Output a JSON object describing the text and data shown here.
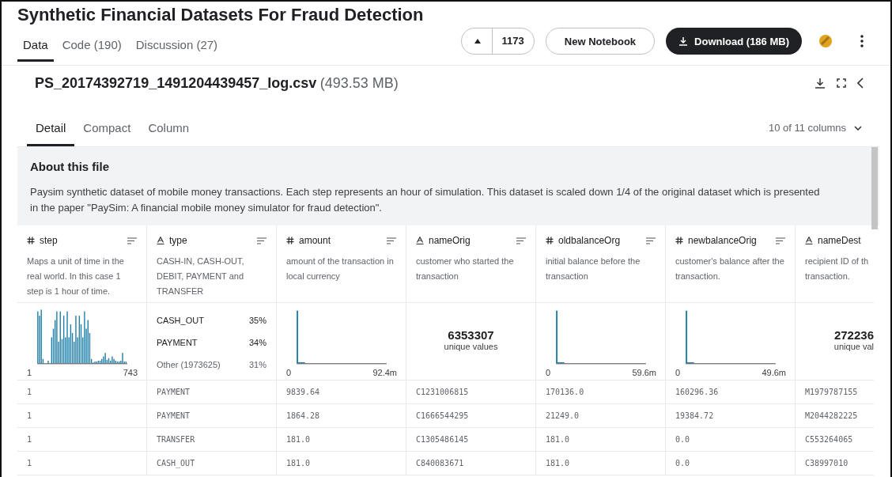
{
  "title": "Synthetic Financial Datasets For Fraud Detection",
  "tabs": [
    {
      "label": "Data",
      "selected": true
    },
    {
      "label": "Code (190)",
      "selected": false
    },
    {
      "label": "Discussion (27)",
      "selected": false
    }
  ],
  "upvote": {
    "count": "1173"
  },
  "new_notebook": "New Notebook",
  "download": "Download (186 MB)",
  "file": {
    "name": "PS_20174392719_1491204439457_log.csv",
    "size": "(493.53 MB)"
  },
  "view_tabs": [
    {
      "label": "Detail",
      "selected": true
    },
    {
      "label": "Compact",
      "selected": false
    },
    {
      "label": "Column",
      "selected": false
    }
  ],
  "columns_selector": "10 of 11 columns",
  "about": {
    "heading": "About this file",
    "text": "Paysim synthetic dataset of mobile money transactions. Each step represents an hour of simulation. This dataset is scaled down 1/4 of the original dataset which is presented in the paper \"PaySim: A financial mobile money simulator for fraud detection\"."
  },
  "table": {
    "columns": [
      {
        "name": "step",
        "kind": "numeric",
        "description": "Maps a unit of time in the real world. In this case 1 step is 1 hour of time.",
        "summary": {
          "kind": "histogram",
          "min": "1",
          "max": "743"
        }
      },
      {
        "name": "type",
        "kind": "string",
        "description": "CASH-IN, CASH-OUT, DEBIT, PAYMENT and TRANSFER",
        "summary": {
          "kind": "categories",
          "items": [
            {
              "label": "CASH_OUT",
              "share": "35%",
              "other": false
            },
            {
              "label": "PAYMENT",
              "share": "34%",
              "other": false
            },
            {
              "label": "Other (1973625)",
              "share": "31%",
              "other": true
            }
          ]
        }
      },
      {
        "name": "amount",
        "kind": "numeric",
        "description": "amount of the transaction in local currency",
        "summary": {
          "kind": "spike",
          "min": "0",
          "max": "92.4m"
        }
      },
      {
        "name": "nameOrig",
        "kind": "string",
        "description": "customer who started the transaction",
        "summary": {
          "kind": "unique",
          "count": "6353307",
          "label": "unique values"
        }
      },
      {
        "name": "oldbalanceOrg",
        "kind": "numeric",
        "description": "initial balance before the transaction",
        "summary": {
          "kind": "spike",
          "min": "0",
          "max": "59.6m"
        }
      },
      {
        "name": "newbalanceOrig",
        "kind": "numeric",
        "description": "customer's balance after the transaction.",
        "summary": {
          "kind": "spike",
          "min": "0",
          "max": "49.6m"
        }
      },
      {
        "name": "nameDest",
        "kind": "string",
        "description": "recipient ID of th\ntransaction.",
        "summary": {
          "kind": "unique",
          "count": "272236",
          "label": "unique val"
        }
      }
    ],
    "rows": [
      [
        "1",
        "PAYMENT",
        "9839.64",
        "C1231006815",
        "170136.0",
        "160296.36",
        "M1979787155"
      ],
      [
        "1",
        "PAYMENT",
        "1864.28",
        "C1666544295",
        "21249.0",
        "19384.72",
        "M2044282225"
      ],
      [
        "1",
        "TRANSFER",
        "181.0",
        "C1305486145",
        "181.0",
        "0.0",
        "C553264065"
      ],
      [
        "1",
        "CASH_OUT",
        "181.0",
        "C840083671",
        "181.0",
        "0.0",
        "C38997010"
      ]
    ]
  }
}
